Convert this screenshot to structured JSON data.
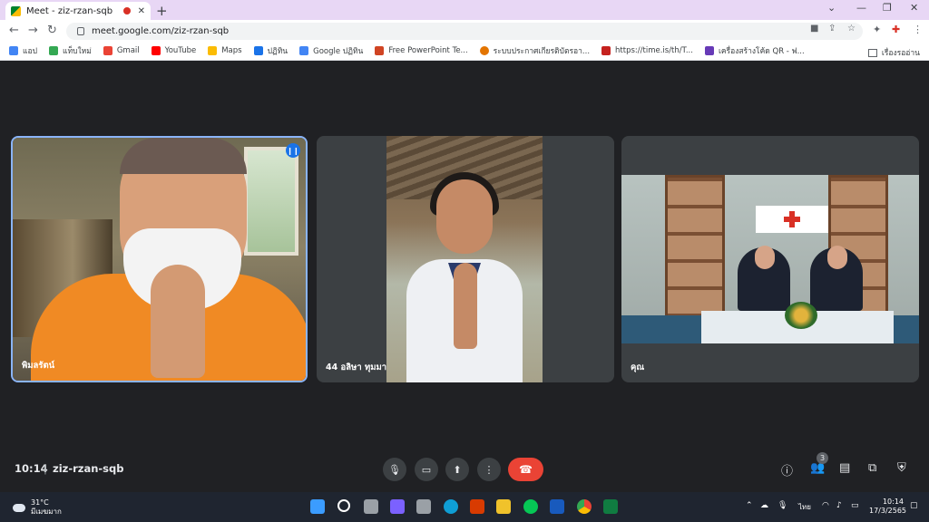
{
  "browser": {
    "tab_title": "Meet - ziz-rzan-sqb",
    "new_tab": "+",
    "close_tab": "✕",
    "url": "meet.google.com/ziz-rzan-sqb",
    "bookmarks": [
      {
        "label": "แอป",
        "color": "#4285f4"
      },
      {
        "label": "แท็บใหม่",
        "color": "#34a853"
      },
      {
        "label": "Gmail",
        "color": "#ea4335"
      },
      {
        "label": "YouTube",
        "color": "#ff0000"
      },
      {
        "label": "Maps",
        "color": "#fbbc04"
      },
      {
        "label": "ปฏิทิน",
        "color": "#1a73e8"
      },
      {
        "label": "Google ปฏิทิน",
        "color": "#4285f4"
      },
      {
        "label": "Free PowerPoint Te...",
        "color": "#d04423"
      },
      {
        "label": "ระบบประกาศเกียรติบัตรอา...",
        "color": "#e37400"
      },
      {
        "label": "https://time.is/th/T...",
        "color": "#c5221f"
      },
      {
        "label": "เครื่องสร้างโค้ด QR - ฟ...",
        "color": "#673ab7"
      }
    ],
    "reading_list": "เรื่องรออ่าน"
  },
  "meet": {
    "participants": [
      {
        "name": "พิมลรัตน์"
      },
      {
        "name": "44 อลิษา ทุมมา"
      },
      {
        "name": "คุณ"
      }
    ],
    "time": "10:14",
    "separator": "|",
    "meeting_code": "ziz-rzan-sqb",
    "people_count": "3"
  },
  "taskbar": {
    "temperature": "31°C",
    "weather_text": "มีเมฆมาก",
    "language": "ไทย",
    "time": "10:14",
    "date": "17/3/2565"
  },
  "colors": {
    "meet_bg": "#202124",
    "tile_bg": "#3c4043",
    "active_border": "#8ab4f8",
    "end_call": "#ea4335"
  }
}
